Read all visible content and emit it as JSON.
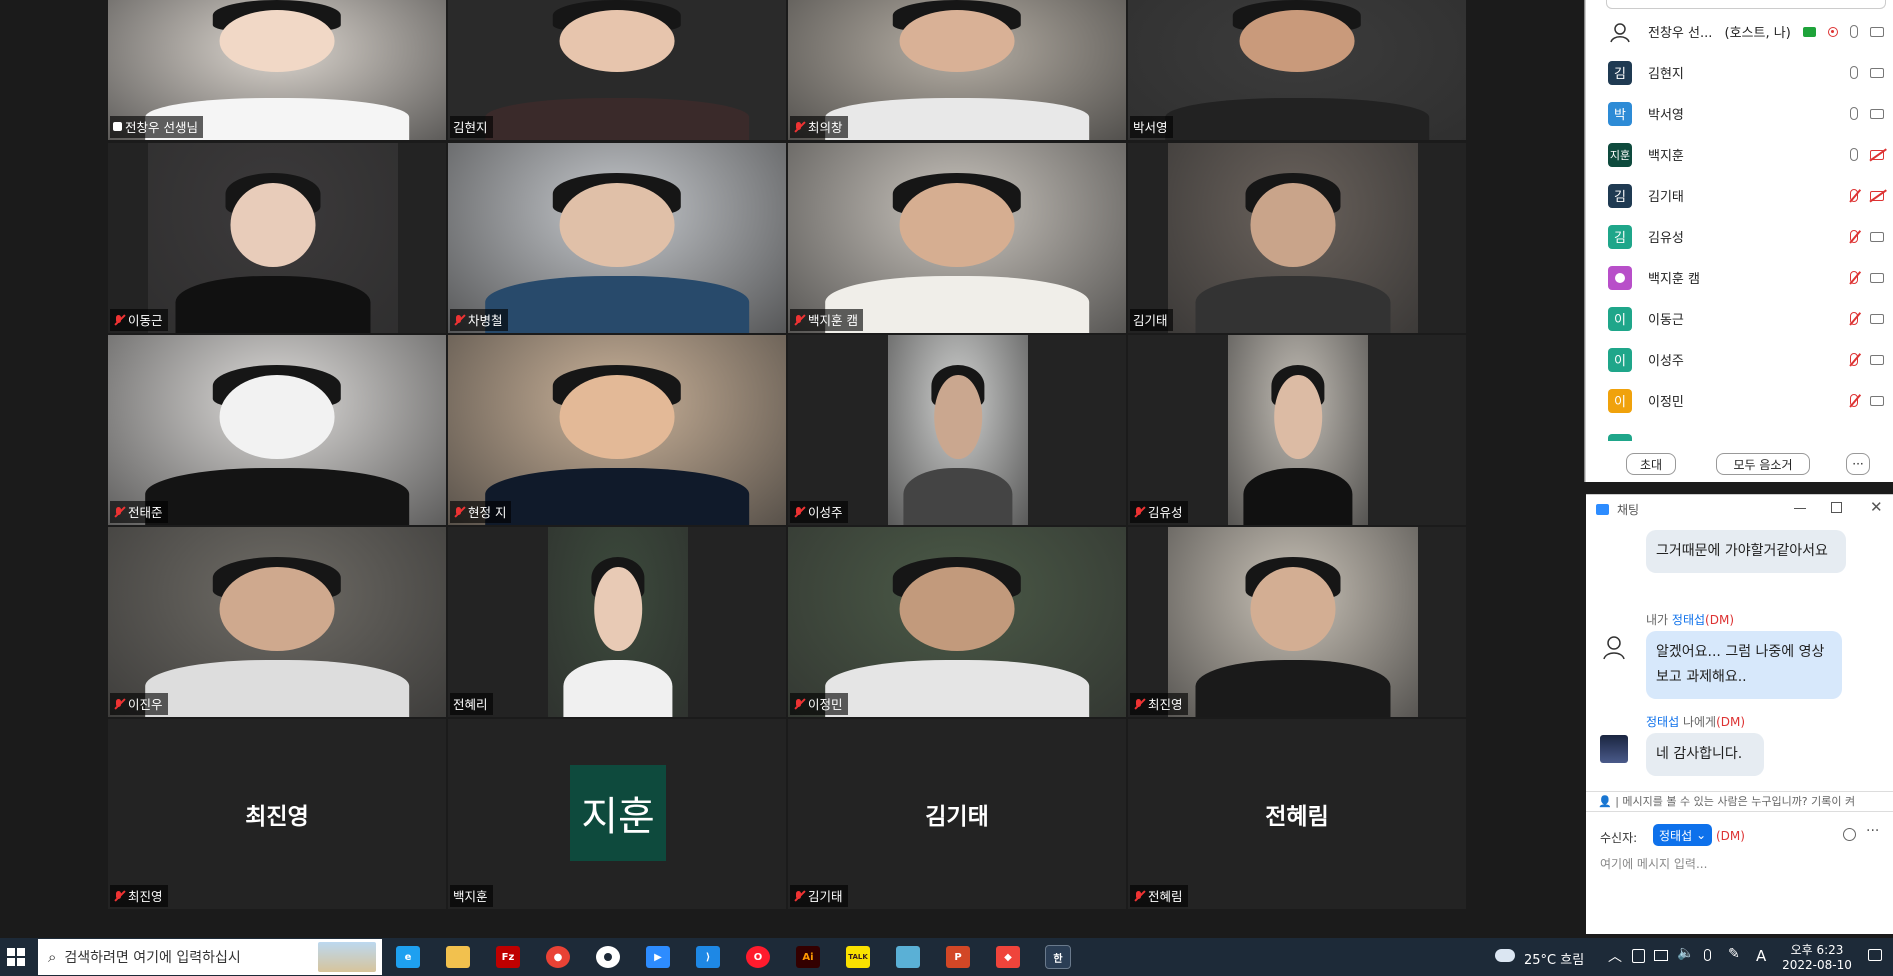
{
  "tiles": [
    {
      "name": "전창우 선생님",
      "muted": false,
      "active": true
    },
    {
      "name": "김현지",
      "muted": false
    },
    {
      "name": "최의창",
      "muted": true
    },
    {
      "name": "박서영",
      "muted": false
    },
    {
      "name": "이동근",
      "muted": true
    },
    {
      "name": "차병철",
      "muted": true
    },
    {
      "name": "백지훈 캠",
      "muted": true
    },
    {
      "name": "김기태",
      "muted": false
    },
    {
      "name": "전태준",
      "muted": true
    },
    {
      "name": "현정 지",
      "muted": true
    },
    {
      "name": "이성주",
      "muted": true
    },
    {
      "name": "김유성",
      "muted": true
    },
    {
      "name": "이진우",
      "muted": true
    },
    {
      "name": "전혜리",
      "muted": false
    },
    {
      "name": "이정민",
      "muted": true
    },
    {
      "name": "최진영",
      "muted": true
    },
    {
      "name": "최진영",
      "muted": true,
      "big": "최진영"
    },
    {
      "name": "백지훈",
      "muted": false,
      "avatar": "지훈"
    },
    {
      "name": "김기태",
      "muted": true,
      "big": "김기태"
    },
    {
      "name": "전혜림",
      "muted": true,
      "big": "전혜림"
    }
  ],
  "participants": {
    "rows": [
      {
        "initial": "",
        "name": "전창우 선...",
        "role": "(호스트, 나)",
        "color": "#ffffff",
        "mic": "on",
        "cam": "on",
        "host": true
      },
      {
        "initial": "김",
        "name": "김현지",
        "color": "#1f3a52",
        "mic": "on",
        "cam": "on"
      },
      {
        "initial": "박",
        "name": "박서영",
        "color": "#2d8bd6",
        "mic": "on",
        "cam": "on"
      },
      {
        "initial": "지훈",
        "name": "백지훈",
        "color": "#0e4a3d",
        "mic": "on",
        "cam": "off"
      },
      {
        "initial": "김",
        "name": "김기태",
        "color": "#1f3a52",
        "mic": "off",
        "cam": "off"
      },
      {
        "initial": "김",
        "name": "김유성",
        "color": "#1fa68a",
        "mic": "off",
        "cam": "on"
      },
      {
        "initial": "",
        "name": "백지훈 캠",
        "color": "#b84fc9",
        "mic": "off",
        "cam": "on"
      },
      {
        "initial": "이",
        "name": "이동근",
        "color": "#1fa68a",
        "mic": "off",
        "cam": "on"
      },
      {
        "initial": "이",
        "name": "이성주",
        "color": "#1fa68a",
        "mic": "off",
        "cam": "on"
      },
      {
        "initial": "이",
        "name": "이정민",
        "color": "#f0a20c",
        "mic": "off",
        "cam": "on"
      }
    ],
    "invite_label": "초대",
    "mute_all_label": "모두 음소거",
    "more_label": "···"
  },
  "chat": {
    "title": "채팅",
    "messages": [
      {
        "text": "그거때문에 가야할거같아서요"
      },
      {
        "sender_prefix": "내가",
        "sender_name": "정태섭",
        "dm": "(DM)",
        "text": "알겠어요... 그럼 나중에 영상보고 과제해요.."
      },
      {
        "sender_name": "정태섭",
        "sender_suffix": "나에게",
        "dm": "(DM)",
        "text": "네 감사합니다."
      }
    ],
    "visibility_note": "메시지를 볼 수 있는 사람은 누구입니까? 기록이 켜",
    "to_label": "수신자:",
    "to_value": "정태섭",
    "to_dm": "(DM)",
    "input_placeholder": "여기에 메시지 입력..."
  },
  "taskbar": {
    "search_placeholder": "검색하려면 여기에 입력하십시",
    "weather": "25°C 흐림",
    "time": "오후 6:23",
    "date": "2022-08-10",
    "ime": "A",
    "apps": [
      "ie-icon",
      "folder-icon",
      "filezilla-icon",
      "chrome-icon",
      "maps-icon",
      "zoom-icon",
      "vscode-icon",
      "opera-icon",
      "illustrator-icon",
      "kakaotalk-icon",
      "notes-icon",
      "powerpoint-icon",
      "anydesk-icon",
      "hangul-icon"
    ]
  }
}
